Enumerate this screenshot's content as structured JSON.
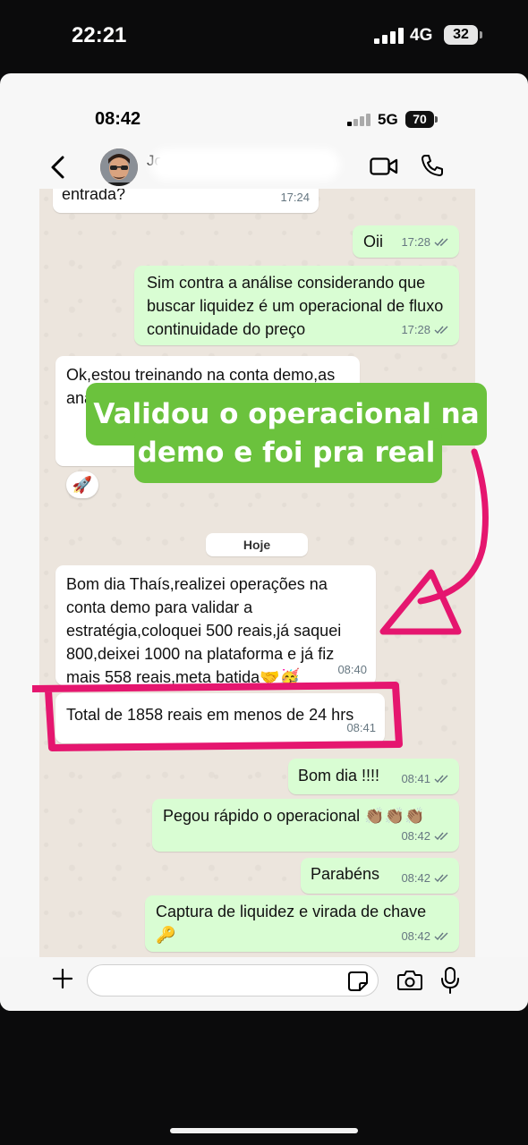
{
  "outer_status": {
    "time": "22:21",
    "network": "4G",
    "battery": "32"
  },
  "inner_status": {
    "time": "08:42",
    "network": "5G",
    "battery": "70"
  },
  "header": {
    "contact_name": "Jo"
  },
  "messages": [
    {
      "dir": "in",
      "text": "entrada?",
      "time": "17:24"
    },
    {
      "dir": "out",
      "text": "Oii",
      "time": "17:28"
    },
    {
      "dir": "out",
      "text": "Sim contra a análise considerando que buscar liquidez é um operacional de fluxo continuidade do preço",
      "time": "17:28"
    },
    {
      "dir": "in",
      "text": "Ok,estou treinando na conta demo,as ana",
      "time": ""
    },
    {
      "dir": "in",
      "text": "Bom dia Thaís,realizei operações na conta demo para validar a estratégia,coloquei 500 reais,já saquei 800,deixei 1000 na plataforma e já fiz mais 558 reais,meta batida🤝🥳",
      "time": "08:40"
    },
    {
      "dir": "in",
      "text": "Total de 1858 reais em menos de 24 hrs",
      "time": "08:41"
    },
    {
      "dir": "out",
      "text": "Bom dia !!!!",
      "time": "08:41"
    },
    {
      "dir": "out",
      "text": "Pegou rápido o operacional 👏🏽👏🏽👏🏽",
      "time": "08:42"
    },
    {
      "dir": "out",
      "text": "Parabéns",
      "time": "08:42"
    },
    {
      "dir": "out",
      "text": "Captura de liquidez e virada de chave 🔑",
      "time": "08:42"
    }
  ],
  "reaction": "🚀",
  "day_separator": "Hoje",
  "input": {
    "placeholder": ""
  },
  "overlay": {
    "banner": "Validou o operacional na demo e foi pra real",
    "banner_color": "#6bc23d",
    "annotation_color": "#e5166f"
  },
  "icons": [
    "chevron-left-icon",
    "video-call-icon",
    "phone-icon",
    "plus-icon",
    "sticker-icon",
    "camera-icon",
    "mic-icon",
    "double-check-icon"
  ]
}
